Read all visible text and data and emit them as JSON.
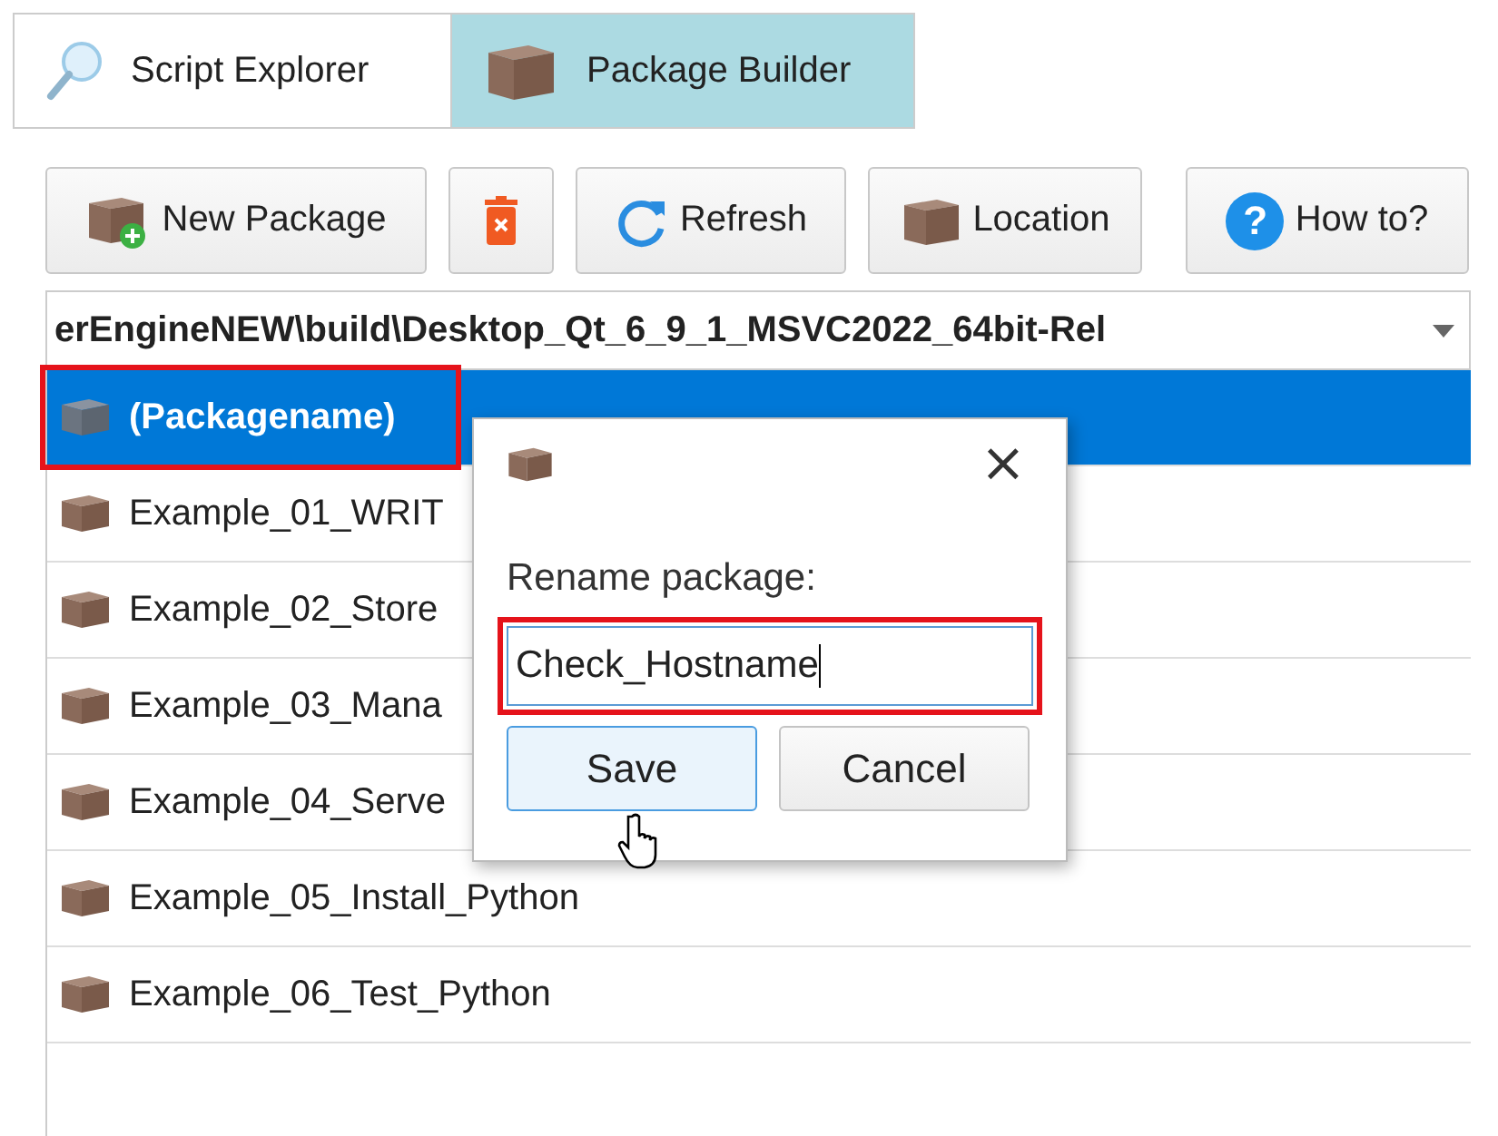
{
  "tabs": [
    {
      "label": "Script Explorer",
      "kind": "search",
      "selected": false
    },
    {
      "label": "Package Builder",
      "kind": "box",
      "selected": true
    }
  ],
  "toolbar": [
    {
      "label": "New Package",
      "kind": "new"
    },
    {
      "kind": "delete"
    },
    {
      "label": "Refresh",
      "kind": "refresh"
    },
    {
      "label": "Location",
      "kind": "box"
    },
    {
      "label": "How to?",
      "kind": "help",
      "glyph": "?"
    }
  ],
  "path": "erEngineNEW\\build\\Desktop_Qt_6_9_1_MSVC2022_64bit-Rel",
  "packages": [
    {
      "name": "(Packagename)",
      "selected": true,
      "highlighted": true
    },
    {
      "name": "Example_01_WRIT",
      "selected": false,
      "highlighted": false
    },
    {
      "name": "Example_02_Store",
      "selected": false,
      "highlighted": false
    },
    {
      "name": "Example_03_Mana",
      "selected": false,
      "highlighted": false
    },
    {
      "name": "Example_04_Serve",
      "selected": false,
      "highlighted": false
    },
    {
      "name": "Example_05_Install_Python",
      "selected": false,
      "highlighted": false
    },
    {
      "name": "Example_06_Test_Python",
      "selected": false,
      "highlighted": false
    }
  ],
  "dialog": {
    "close": "×",
    "label": "Rename package:",
    "field": {
      "value": "Check_Hostname",
      "highlighted": true
    },
    "buttons": [
      {
        "label": "Save",
        "default": true
      },
      {
        "label": "Cancel",
        "default": false
      }
    ]
  }
}
